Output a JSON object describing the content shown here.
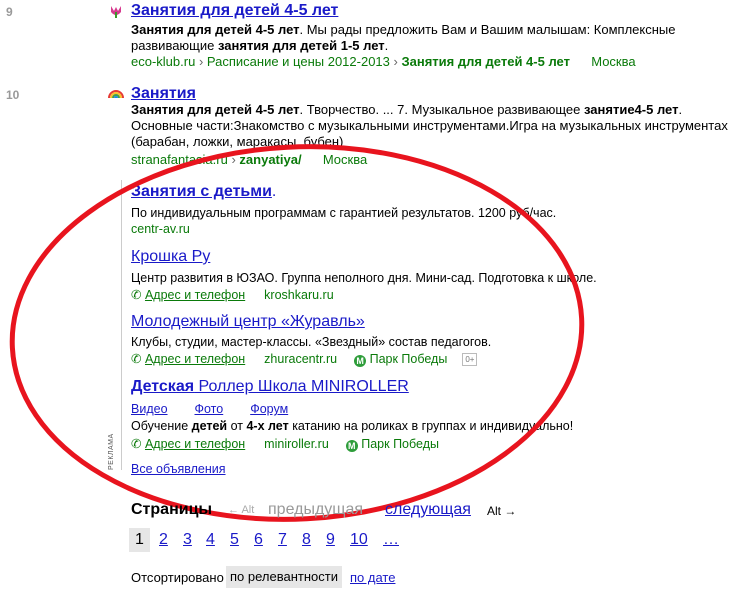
{
  "results": [
    {
      "num": "9",
      "title": "Занятия для детей 4-5 лет",
      "snippet_line1": "Занятия для детей 4-5 лет. Мы рады предложить Вам и Вашим малышам: Комплексные",
      "snippet_line2": "развивающие занятия для детей 1-5 лет.",
      "domain": "eco-klub.ru",
      "crumb1": "Расписание и цены 2012-2013",
      "crumb2": "Занятия для детей 4-5 лет",
      "region": "Москва"
    },
    {
      "num": "10",
      "title": "Занятия",
      "snippet_line1": "Занятия для детей 4-5 лет. Творчество. ... 7. Музыкальное развивающее занятие4-5 лет.",
      "snippet_line2": "Основные части:Знакомство с музыкальными инструментами.Игра на музыкальных инструментах",
      "snippet_line3": "(барабан, ложки, маракасы, бубен)",
      "domain": "stranafantasia.ru",
      "crumb1": "zanyatiya/",
      "region": "Москва"
    }
  ],
  "ads_label": "РЕКЛАМА",
  "ads": [
    {
      "title": "Занятия с детьми",
      "dot": ".",
      "text": "По индивидуальным программам с гарантией результатов. 1200 руб/час.",
      "domain": "centr-av.ru"
    },
    {
      "title": "Крошка Ру",
      "text": "Центр развития в ЮЗАО. Группа неполного дня. Мини-сад. Подготовка к школе.",
      "addr": "Адрес и телефон",
      "domain": "kroshkaru.ru"
    },
    {
      "title": "Молодежный центр «Журавль»",
      "text": "Клубы, студии, мастер-классы. «Звездный» состав педагогов.",
      "addr": "Адрес и телефон",
      "domain": "zhuracentr.ru",
      "metro": "Парк Победы",
      "age": "0+"
    },
    {
      "title_bold": "Детская",
      "title_rest": " Роллер Школа MINIROLLER",
      "sitelinks": [
        "Видео",
        "Фото",
        "Форум"
      ],
      "text": "Обучение детей от 4-х лет катанию на роликах в группах и индивидуально!",
      "addr": "Адрес и телефон",
      "domain": "miniroller.ru",
      "metro": "Парк Победы"
    }
  ],
  "all_ads": "Все объявления",
  "pager": {
    "label": "Страницы",
    "prev_hint": "← Alt",
    "prev": "предыдущая",
    "next": "следующая",
    "next_hint": "Alt →",
    "pages": [
      "1",
      "2",
      "3",
      "4",
      "5",
      "6",
      "7",
      "8",
      "9",
      "10",
      "…"
    ],
    "current": "1"
  },
  "sort": {
    "label": "Отсортировано",
    "active": "по релевантности",
    "alt": "по дате"
  },
  "colors": {
    "link": "#1a1ac8",
    "url_green": "#0a7a0a",
    "oval": "#e8141e"
  }
}
